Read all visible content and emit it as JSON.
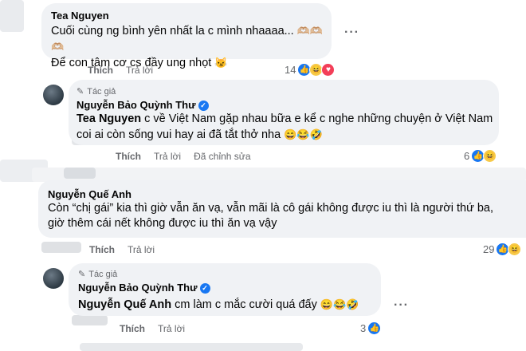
{
  "comments": [
    {
      "name": "Tea Nguyen",
      "line1": "Cuối cùng ng bình yên nhất la c mình nhaaaa...",
      "line1_emoji": "🫶🏼🫶🏼🫶🏼",
      "line2": "Để con tâm cơ cs đầy ung nhọt",
      "line2_emoji": "😼",
      "like_label": "Thích",
      "reply_label": "Trả lời",
      "reaction_count": "14"
    },
    {
      "author_tag": "Tác giả",
      "name": "Nguyễn Bảo Quỳnh Thư",
      "mention": "Tea Nguyen",
      "line1": "c về Việt Nam gặp nhau bữa e kể c nghe những chuyện ở Việt Nam",
      "line2": "coi ai còn sống vui hay ai đã tắt thở nha",
      "line2_emoji": "😄😂🤣",
      "like_label": "Thích",
      "reply_label": "Trả lời",
      "edited_label": "Đã chỉnh sửa",
      "reaction_count": "6"
    },
    {
      "name": "Nguyễn Quế Anh",
      "line1": "Còn “chị gái” kia thì giờ vẫn ăn vạ, vẫn mãi là cô gái không được iu thì là người thứ ba,",
      "line2": "giờ thêm cái nết không được iu thì ăn vạ vậy",
      "like_label": "Thích",
      "reply_label": "Trả lời",
      "reaction_count": "29"
    },
    {
      "author_tag": "Tác giả",
      "name": "Nguyễn Bảo Quỳnh Thư",
      "mention": "Nguyễn Quế Anh",
      "line1": "cm làm c mắc cười quá đấy",
      "line1_emoji": "😄😂🤣",
      "like_label": "Thích",
      "reply_label": "Trả lời",
      "reaction_count": "3"
    }
  ],
  "icons": {
    "more": "···",
    "pencil": "✎",
    "verified": "✓",
    "like": "👍",
    "haha": "😆",
    "love": "♥"
  }
}
